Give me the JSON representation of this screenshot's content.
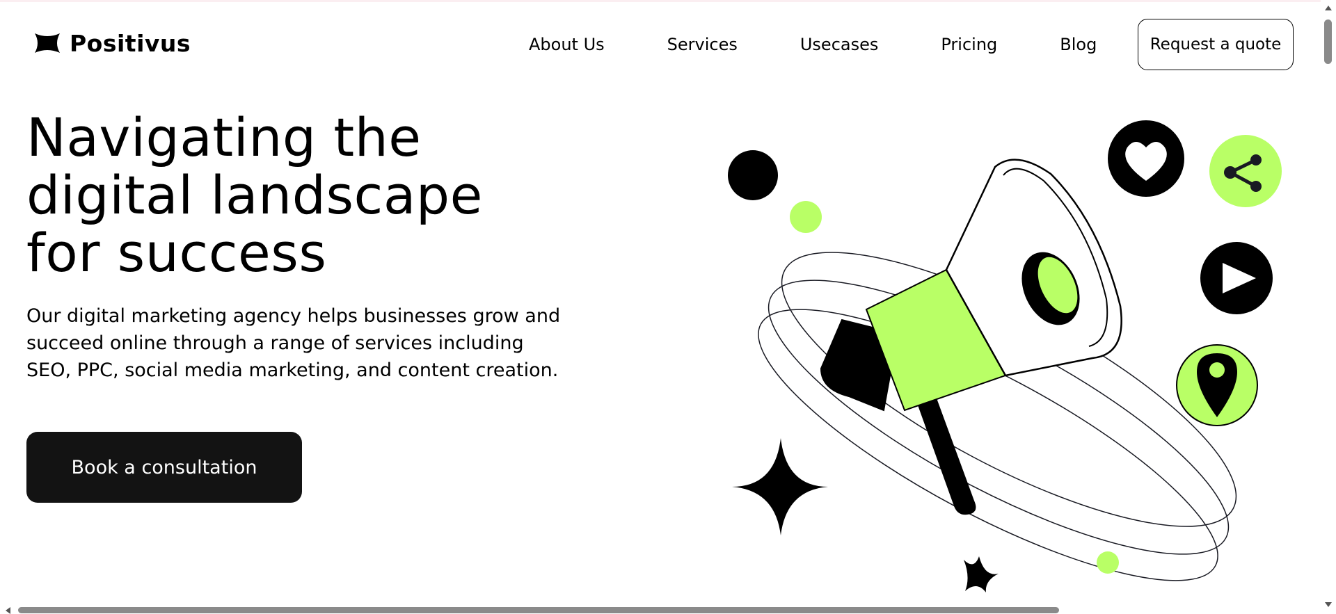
{
  "brand": {
    "name": "Positivus"
  },
  "nav": {
    "links": [
      "About Us",
      "Services",
      "Usecases",
      "Pricing",
      "Blog"
    ],
    "cta_label": "Request a quote"
  },
  "hero": {
    "title_lines": [
      "Navigating the",
      "digital landscape",
      "for success"
    ],
    "description": "Our digital marketing agency helps businesses grow and succeed online through a range of services including SEO, PPC, social media marketing, and content creation.",
    "cta_label": "Book a consultation"
  },
  "colors": {
    "accent_green": "#B9FF66",
    "dark": "#191A23",
    "button_dark": "#131313"
  },
  "icons": [
    "star-logo-icon",
    "heart-icon",
    "share-icon",
    "play-icon",
    "location-pin-icon",
    "megaphone-illustration",
    "sparkle-star-icon"
  ]
}
